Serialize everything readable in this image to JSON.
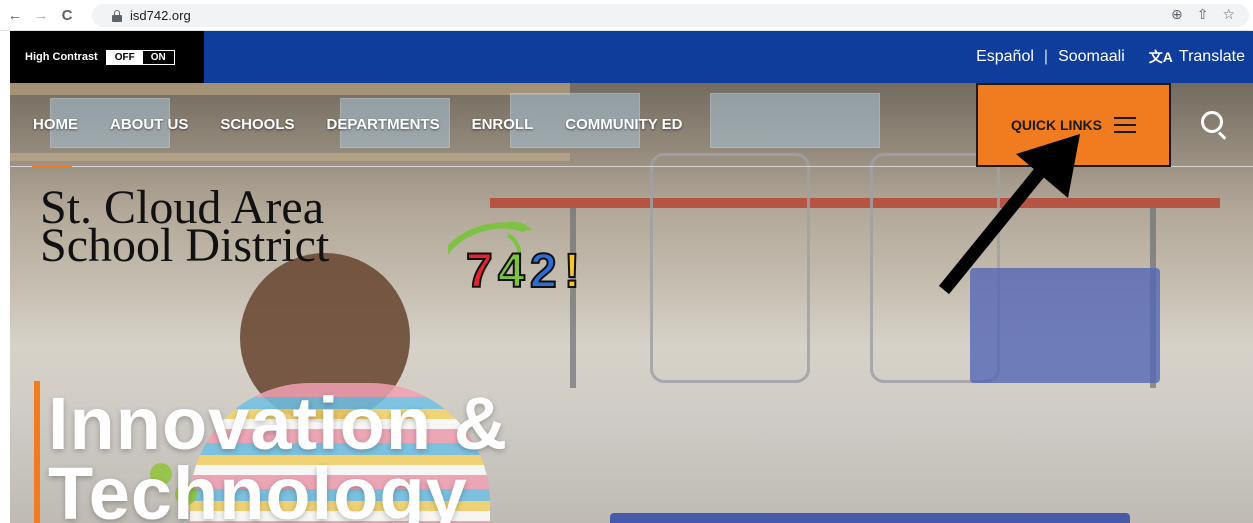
{
  "browser": {
    "url": "isd742.org",
    "back_glyph": "←",
    "forward_glyph": "→",
    "reload_glyph": "C",
    "zoom_glyph": "⊕",
    "share_glyph": "⇧",
    "star_glyph": "☆"
  },
  "utility": {
    "contrast_label": "High Contrast",
    "toggle_off": "OFF",
    "toggle_on": "ON",
    "languages": [
      "Español",
      "Soomaali"
    ],
    "separator": "|",
    "translate_icon": "文A",
    "translate_label": "Translate"
  },
  "nav": {
    "items": [
      "HOME",
      "ABOUT US",
      "SCHOOLS",
      "DEPARTMENTS",
      "ENROLL",
      "COMMUNITY ED"
    ],
    "quick_links": "QUICK LINKS"
  },
  "logo": {
    "line1": "St. Cloud Area",
    "line2": "School District",
    "badge_parts": [
      "7",
      "4",
      "2",
      "!"
    ]
  },
  "hero": {
    "line1": "Innovation &",
    "line2": "Technology"
  },
  "colors": {
    "brand_blue": "#0f3d9c",
    "accent_orange": "#f07c1f"
  }
}
